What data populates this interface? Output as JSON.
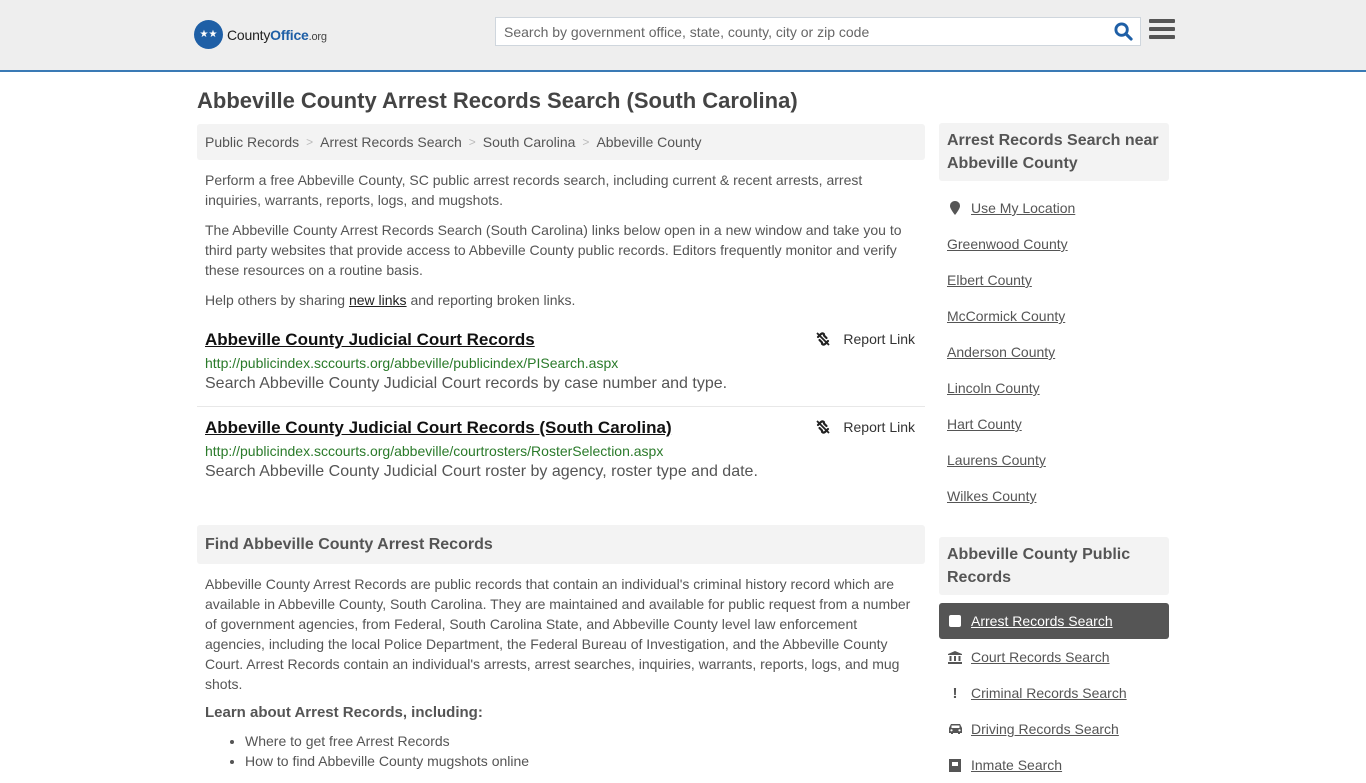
{
  "header": {
    "logo": {
      "name_part1": "County",
      "name_part2": "Office",
      "tld": ".org"
    },
    "search": {
      "placeholder": "Search by government office, state, county, city or zip code",
      "value": ""
    }
  },
  "page_title": "Abbeville County Arrest Records Search (South Carolina)",
  "breadcrumb": [
    "Public Records",
    "Arrest Records Search",
    "South Carolina",
    "Abbeville County"
  ],
  "intro": {
    "p1": "Perform a free Abbeville County, SC public arrest records search, including current & recent arrests, arrest inquiries, warrants, reports, logs, and mugshots.",
    "p2": "The Abbeville County Arrest Records Search (South Carolina) links below open in a new window and take you to third party websites that provide access to Abbeville County public records. Editors frequently monitor and verify these resources on a routine basis.",
    "p3_before": "Help others by sharing ",
    "p3_link": "new links",
    "p3_after": " and reporting broken links."
  },
  "results": [
    {
      "title": "Abbeville County Judicial Court Records",
      "url": "http://publicindex.sccourts.org/abbeville/publicindex/PISearch.aspx",
      "description": "Search Abbeville County Judicial Court records by case number and type.",
      "report_label": "Report Link"
    },
    {
      "title": "Abbeville County Judicial Court Records (South Carolina)",
      "url": "http://publicindex.sccourts.org/abbeville/courtrosters/RosterSelection.aspx",
      "description": "Search Abbeville County Judicial Court roster by agency, roster type and date.",
      "report_label": "Report Link"
    }
  ],
  "find_section": {
    "heading": "Find Abbeville County Arrest Records",
    "body": "Abbeville County Arrest Records are public records that contain an individual's criminal history record which are available in Abbeville County, South Carolina. They are maintained and available for public request from a number of government agencies, from Federal, South Carolina State, and Abbeville County level law enforcement agencies, including the local Police Department, the Federal Bureau of Investigation, and the Abbeville County Court. Arrest Records contain an individual's arrests, arrest searches, inquiries, warrants, reports, logs, and mug shots.",
    "learn_heading": "Learn about Arrest Records, including:",
    "learn_items": [
      "Where to get free Arrest Records",
      "How to find Abbeville County mugshots online"
    ]
  },
  "sidebar": {
    "nearby": {
      "heading": "Arrest Records Search near Abbeville County",
      "use_location": "Use My Location",
      "counties": [
        "Greenwood County",
        "Elbert County",
        "McCormick County",
        "Anderson County",
        "Lincoln County",
        "Hart County",
        "Laurens County",
        "Wilkes County"
      ]
    },
    "public_records": {
      "heading": "Abbeville County Public Records",
      "items": [
        {
          "label": "Arrest Records Search",
          "icon": "square-icon",
          "active": true
        },
        {
          "label": "Court Records Search",
          "icon": "courthouse-icon",
          "active": false
        },
        {
          "label": "Criminal Records Search",
          "icon": "exclamation-icon",
          "active": false
        },
        {
          "label": "Driving Records Search",
          "icon": "car-icon",
          "active": false
        },
        {
          "label": "Inmate Search",
          "icon": "jail-icon",
          "active": false
        }
      ]
    }
  },
  "colors": {
    "brand_blue": "#1e5fa6",
    "header_border": "#3a7ab5",
    "url_green": "#2a7a2a",
    "active_bg": "#555555"
  }
}
